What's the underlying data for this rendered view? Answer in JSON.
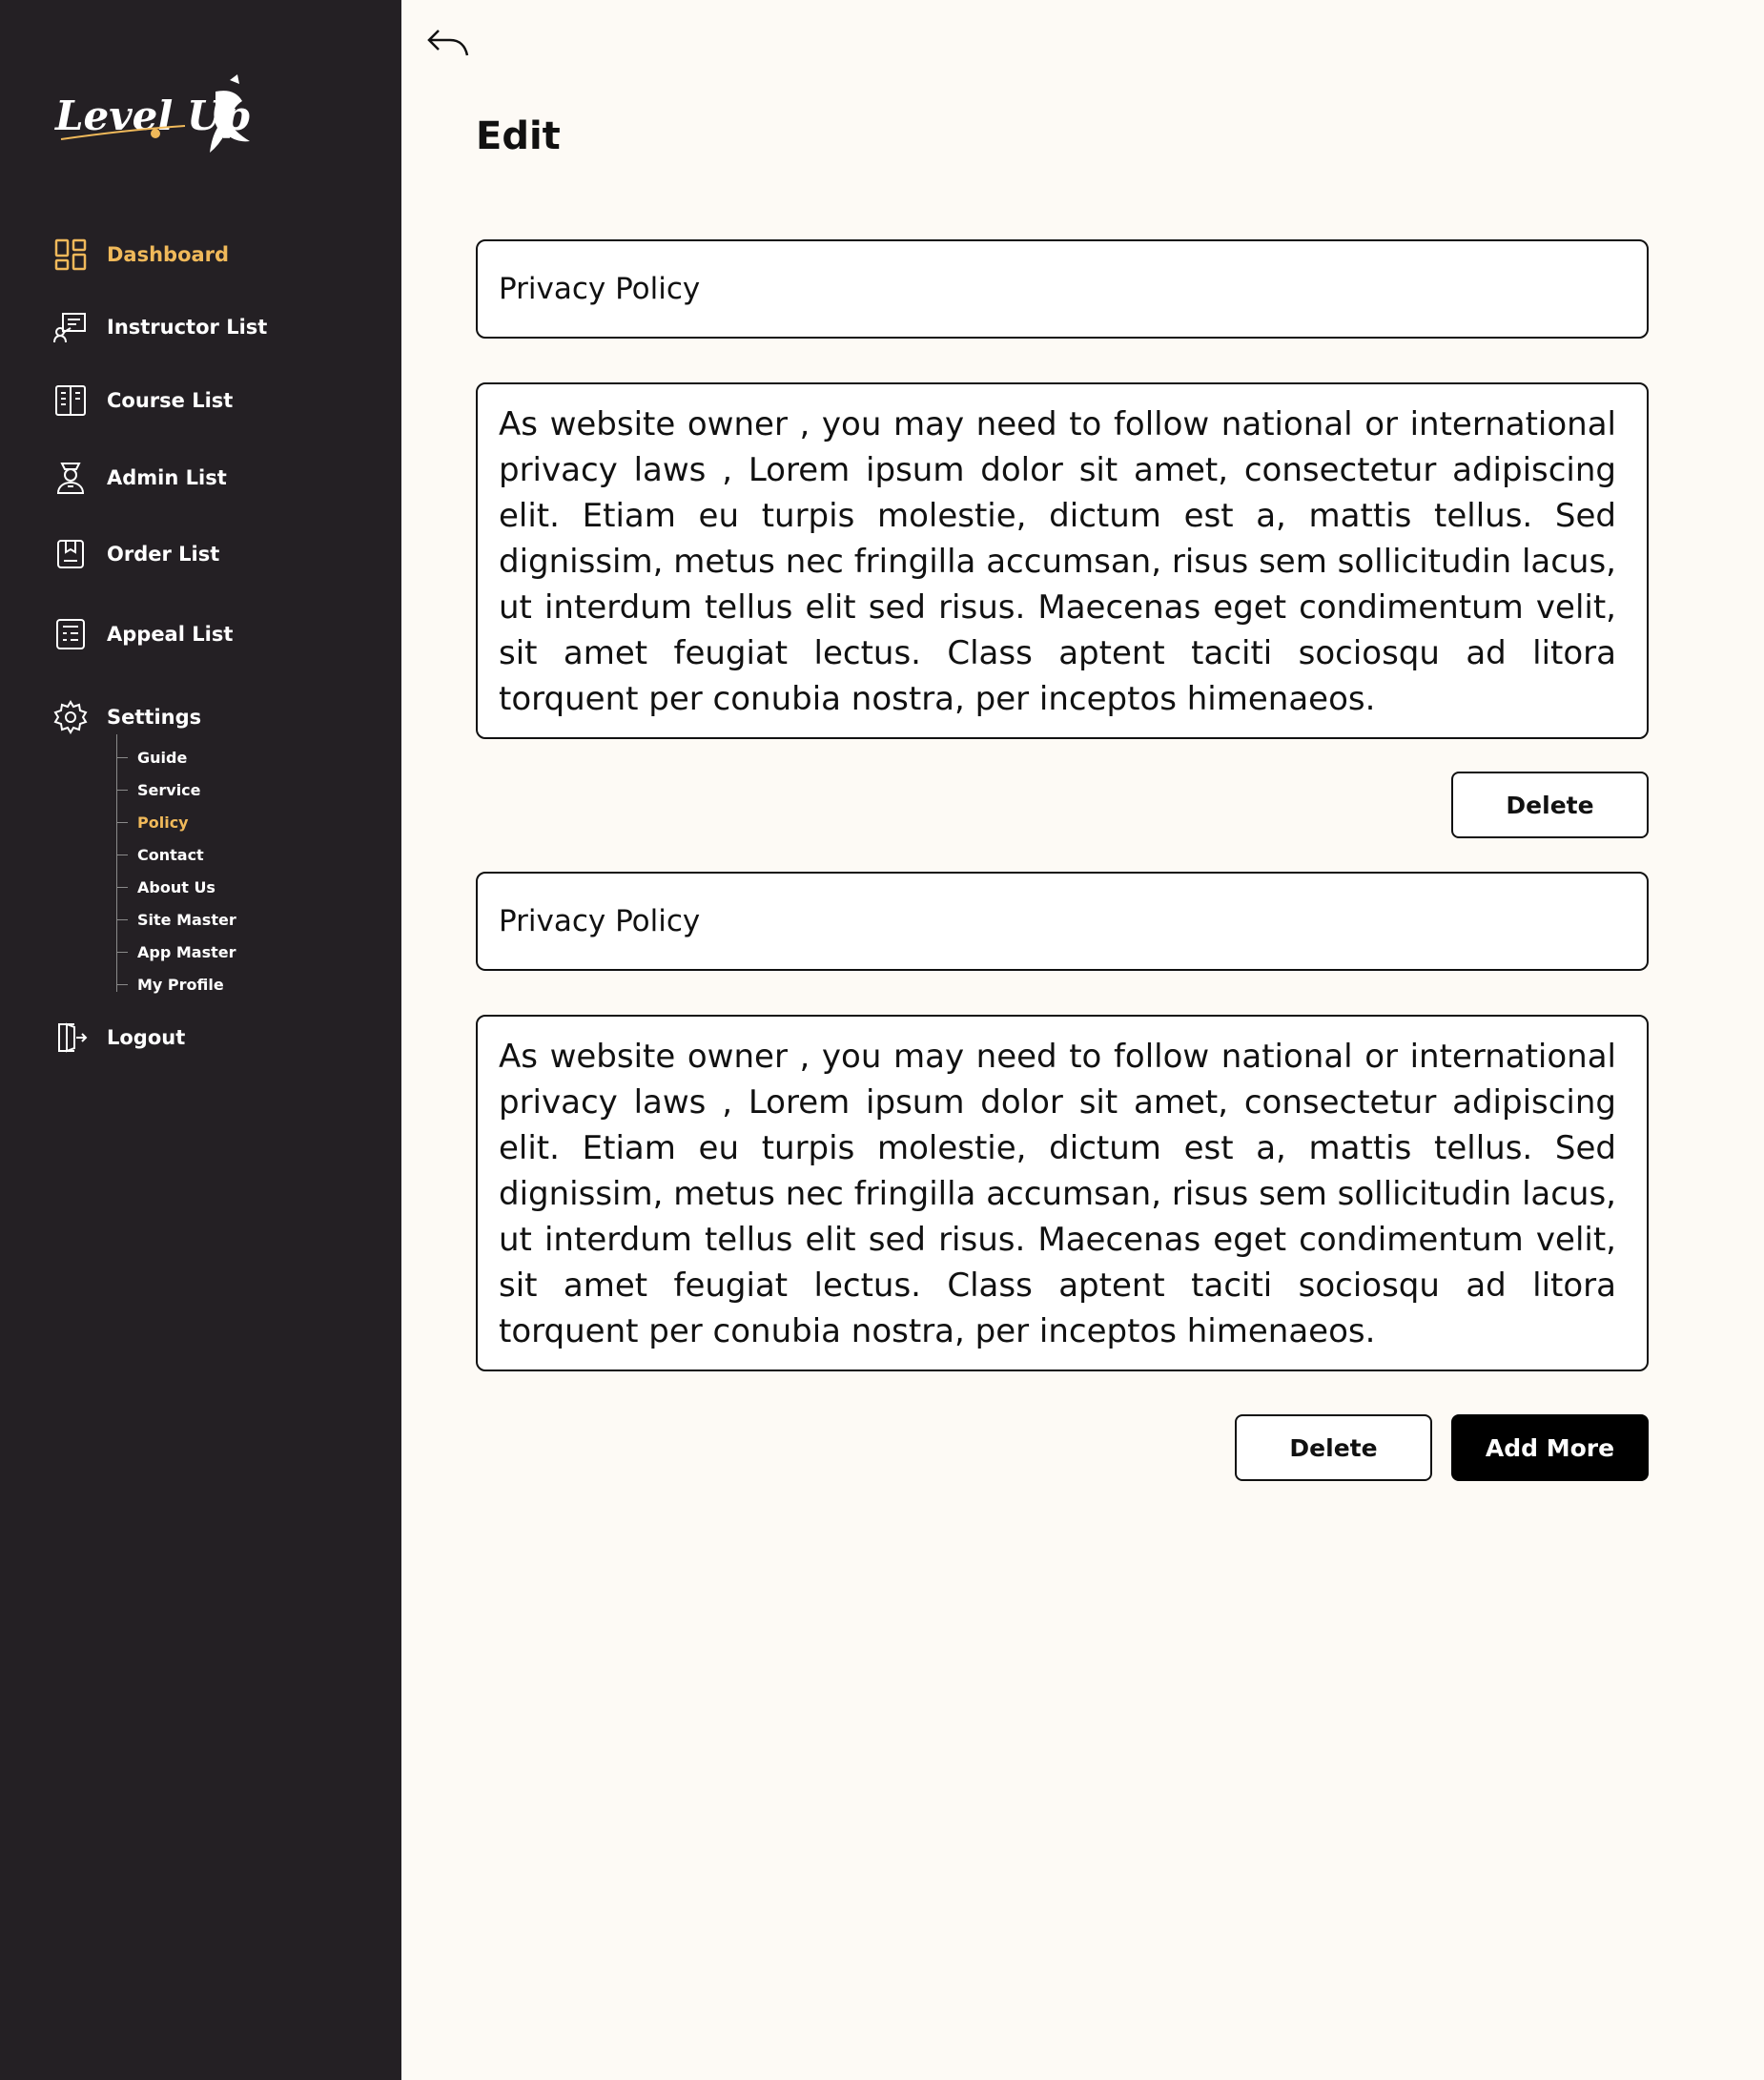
{
  "sidebar": {
    "brand": "Level Up",
    "nav": [
      {
        "label": "Dashboard",
        "icon": "dashboard-icon",
        "active": true
      },
      {
        "label": "Instructor List",
        "icon": "instructor-icon"
      },
      {
        "label": "Course List",
        "icon": "course-icon"
      },
      {
        "label": "Admin List",
        "icon": "admin-icon"
      },
      {
        "label": "Order List",
        "icon": "order-icon"
      },
      {
        "label": "Appeal List",
        "icon": "appeal-icon"
      },
      {
        "label": "Settings",
        "icon": "gear-icon"
      }
    ],
    "settings_sub": [
      {
        "label": "Guide"
      },
      {
        "label": "Service"
      },
      {
        "label": "Policy",
        "active": true
      },
      {
        "label": "Contact"
      },
      {
        "label": "About Us"
      },
      {
        "label": "Site Master"
      },
      {
        "label": "App Master"
      },
      {
        "label": "My Profile"
      }
    ],
    "logout": "Logout"
  },
  "page": {
    "title": "Edit"
  },
  "sections": [
    {
      "title": "Privacy Policy",
      "body": "As website owner , you may need to follow national or international privacy laws , Lorem ipsum dolor sit amet, consectetur adipiscing elit. Etiam eu turpis molestie, dictum est a, mattis tellus. Sed dignissim, metus nec fringilla accumsan, risus sem sollicitudin lacus, ut interdum tellus elit sed risus. Maecenas eget condimentum velit, sit amet feugiat lectus. Class aptent taciti sociosqu ad litora torquent per conubia nostra, per inceptos himenaeos.",
      "delete_label": "Delete"
    },
    {
      "title": "Privacy Policy",
      "body": "As website owner , you may need to follow national or international privacy laws , Lorem ipsum dolor sit amet, consectetur adipiscing elit. Etiam eu turpis molestie, dictum est a, mattis tellus. Sed dignissim, metus nec fringilla accumsan, risus sem sollicitudin lacus, ut interdum tellus elit sed risus. Maecenas eget condimentum velit, sit amet feugiat lectus. Class aptent taciti sociosqu ad litora torquent per conubia nostra, per inceptos himenaeos.",
      "delete_label": "Delete"
    }
  ],
  "actions": {
    "add_more_label": "Add More"
  },
  "colors": {
    "sidebar_bg": "#242024",
    "accent": "#f0b95a",
    "page_bg": "#fdfaf5"
  }
}
